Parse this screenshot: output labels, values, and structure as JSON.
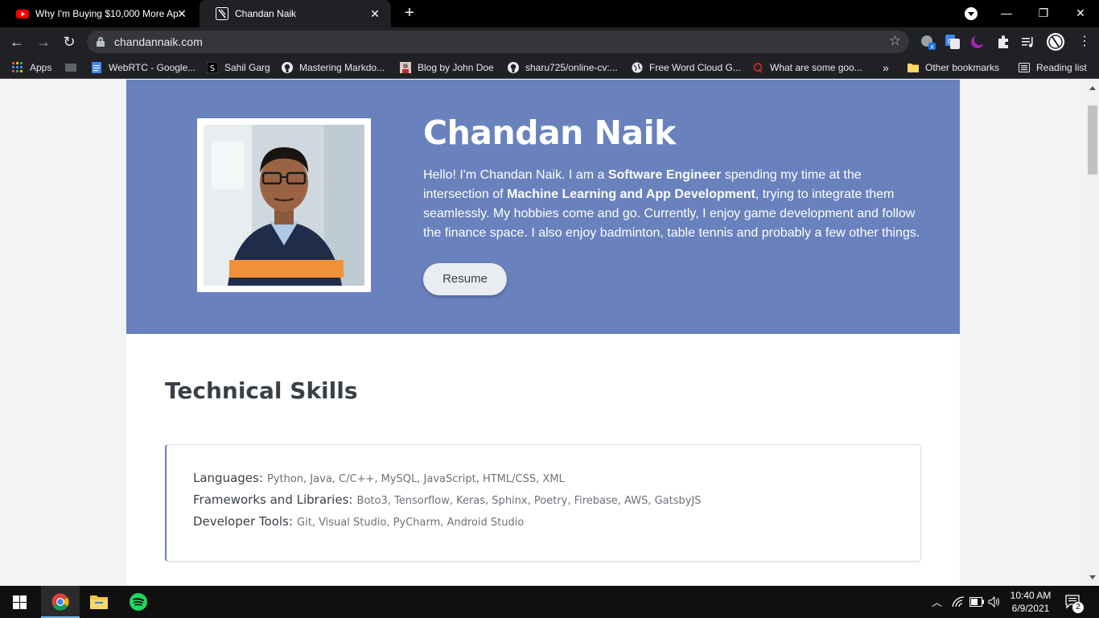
{
  "browser": {
    "tabs": [
      {
        "title": "Why I'm Buying $10,000 More Ap",
        "icon": "youtube-icon"
      },
      {
        "title": "Chandan Naik",
        "icon": "site-icon"
      }
    ],
    "url": "chandannaik.com",
    "bookmarks": [
      {
        "label": "Apps",
        "icon": "apps-grid-icon"
      },
      {
        "label": "WebRTC - Google...",
        "icon": "google-docs-icon"
      },
      {
        "label": "Sahil Garg",
        "icon": "sahil-icon"
      },
      {
        "label": "Mastering Markdo...",
        "icon": "github-icon"
      },
      {
        "label": "Blog by John Doe",
        "icon": "blog-avatar-icon"
      },
      {
        "label": "sharu725/online-cv:...",
        "icon": "github-icon"
      },
      {
        "label": "Free Word Cloud G...",
        "icon": "globe-icon"
      },
      {
        "label": "What are some goo...",
        "icon": "quora-icon"
      },
      {
        "label": "Other bookmarks",
        "icon": "folder-icon"
      },
      {
        "label": "Reading list",
        "icon": "reading-list-icon"
      }
    ],
    "overflow_label": "»"
  },
  "hero": {
    "name": "Chandan Naik",
    "bio_1": "Hello! I'm Chandan Naik. I am a ",
    "bio_bold_1": "Software Engineer",
    "bio_2": " spending my time at the intersection of ",
    "bio_bold_2": "Machine Learning and App Development",
    "bio_3": ", trying to integrate them seamlessly. My hobbies come and go. Currently, I enjoy game development and follow the finance space. I also enjoy badminton, table tennis and probably a few other things.",
    "resume_label": "Resume"
  },
  "skills": {
    "title": "Technical Skills",
    "rows": [
      {
        "key": "Languages:",
        "value": "Python, Java, C/C++, MySQL, JavaScript, HTML/CSS, XML"
      },
      {
        "key": "Frameworks and Libraries:",
        "value": "Boto3, Tensorflow, Keras, Sphinx, Poetry, Firebase, AWS, GatsbyJS"
      },
      {
        "key": "Developer Tools:",
        "value": "Git, Visual Studio, PyCharm, Android Studio"
      }
    ]
  },
  "taskbar": {
    "time": "10:40 AM",
    "date": "6/9/2021",
    "notification_count": "2"
  },
  "colors": {
    "hero_bg": "#6981bd",
    "accent": "#6981bd"
  }
}
